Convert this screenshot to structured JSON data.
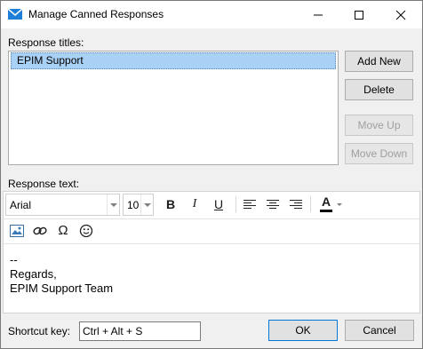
{
  "window": {
    "title": "Manage Canned Responses",
    "controls": {
      "minimize_icon": "minimize-icon",
      "maximize_icon": "maximize-icon",
      "close_icon": "close-icon"
    }
  },
  "responses": {
    "label": "Response titles:",
    "items": [
      {
        "label": "EPIM Support",
        "selected": true
      }
    ]
  },
  "buttons": {
    "add_new": "Add New",
    "delete": "Delete",
    "move_up": "Move Up",
    "move_down": "Move Down",
    "ok": "OK",
    "cancel": "Cancel"
  },
  "editor": {
    "label": "Response text:",
    "font_family": "Arial",
    "font_size": "10",
    "toolbar_row1": [
      "bold-icon",
      "italic-icon",
      "underline-icon",
      "align-left-icon",
      "align-center-icon",
      "align-right-icon",
      "font-color-icon"
    ],
    "toolbar_row2": [
      "insert-image-icon",
      "insert-link-icon",
      "special-character-icon",
      "emoji-icon"
    ],
    "content_lines": [
      "--",
      "Regards,",
      "EPIM Support Team"
    ],
    "font_color": "#000000"
  },
  "shortcut": {
    "label": "Shortcut key:",
    "value": "Ctrl + Alt + S"
  },
  "colors": {
    "selection": "#a9d0f5",
    "dialog_bg": "#f0f0f0",
    "accent": "#0078d7"
  }
}
